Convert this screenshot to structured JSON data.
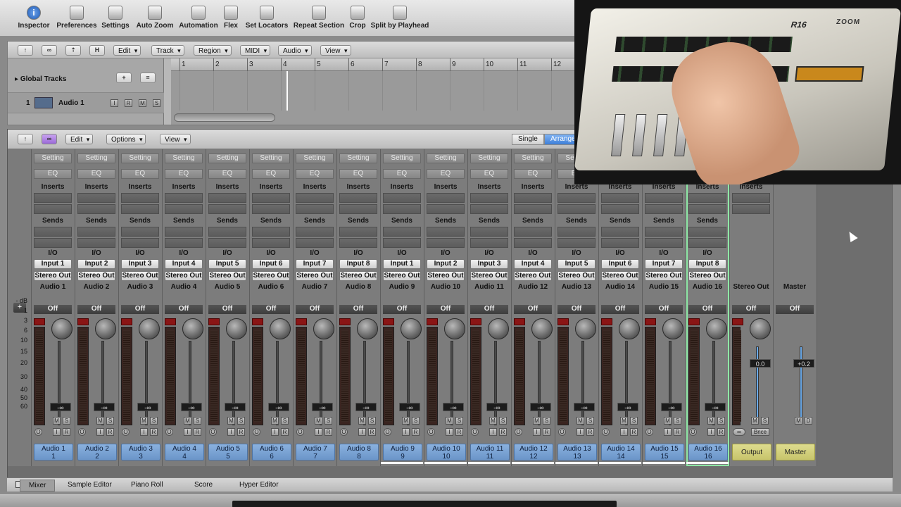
{
  "toolbar": {
    "items": [
      {
        "label": "Inspector",
        "icon": "info-icon"
      },
      {
        "label": "Preferences",
        "icon": "preferences-icon"
      },
      {
        "label": "Settings",
        "icon": "settings-icon"
      },
      {
        "label": "Auto Zoom",
        "icon": "zoom-icon"
      },
      {
        "label": "Automation",
        "icon": "automation-icon"
      },
      {
        "label": "Flex",
        "icon": "flex-icon"
      },
      {
        "label": "Set Locators",
        "icon": "locators-icon"
      },
      {
        "label": "Repeat Section",
        "icon": "repeat-icon"
      },
      {
        "label": "Crop",
        "icon": "crop-icon"
      },
      {
        "label": "Split by Playhead",
        "icon": "split-icon"
      }
    ]
  },
  "arrange": {
    "menus": [
      "Edit",
      "Track",
      "Region",
      "MIDI",
      "Audio",
      "View"
    ],
    "global_tracks": "Global Tracks",
    "track": {
      "number": "1",
      "name": "Audio 1",
      "buttons": [
        "I",
        "R",
        "M",
        "S"
      ]
    },
    "ruler": [
      "1",
      "2",
      "3",
      "4",
      "5",
      "6",
      "7",
      "8",
      "9",
      "10",
      "11",
      "12"
    ]
  },
  "mixer": {
    "menus": [
      "Edit",
      "Options",
      "View"
    ],
    "view_modes": [
      "Single",
      "Arrange"
    ],
    "active_view": "Arrange",
    "slot_labels": {
      "setting": "Setting",
      "eq": "EQ",
      "inserts": "Inserts",
      "sends": "Sends",
      "io": "I/O",
      "off": "Off"
    },
    "db_scale": [
      "- dB",
      "1",
      "3",
      "6",
      "10",
      "15",
      "20",
      "30",
      "40",
      "50",
      "60"
    ],
    "strips": [
      {
        "input": "Input 1",
        "output": "Stereo Out",
        "name": "Audio 1",
        "tag": "Audio 1",
        "num": "1",
        "val": "-∞"
      },
      {
        "input": "Input 2",
        "output": "Stereo Out",
        "name": "Audio 2",
        "tag": "Audio 2",
        "num": "2",
        "val": "-∞"
      },
      {
        "input": "Input 3",
        "output": "Stereo Out",
        "name": "Audio 3",
        "tag": "Audio 3",
        "num": "3",
        "val": "-∞"
      },
      {
        "input": "Input 4",
        "output": "Stereo Out",
        "name": "Audio 4",
        "tag": "Audio 4",
        "num": "4",
        "val": "-∞"
      },
      {
        "input": "Input 5",
        "output": "Stereo Out",
        "name": "Audio 5",
        "tag": "Audio 5",
        "num": "5",
        "val": "-∞"
      },
      {
        "input": "Input 6",
        "output": "Stereo Out",
        "name": "Audio 6",
        "tag": "Audio 6",
        "num": "6",
        "val": "-∞"
      },
      {
        "input": "Input 7",
        "output": "Stereo Out",
        "name": "Audio 7",
        "tag": "Audio 7",
        "num": "7",
        "val": "-∞"
      },
      {
        "input": "Input 8",
        "output": "Stereo Out",
        "name": "Audio 8",
        "tag": "Audio 8",
        "num": "8",
        "val": "-∞"
      },
      {
        "input": "Input 1",
        "output": "Stereo Out",
        "name": "Audio 9",
        "tag": "Audio 9",
        "num": "9",
        "val": "-∞"
      },
      {
        "input": "Input 2",
        "output": "Stereo Out",
        "name": "Audio 10",
        "tag": "Audio 10",
        "num": "10",
        "val": "-∞"
      },
      {
        "input": "Input 3",
        "output": "Stereo Out",
        "name": "Audio 11",
        "tag": "Audio 11",
        "num": "11",
        "val": "-∞"
      },
      {
        "input": "Input 4",
        "output": "Stereo Out",
        "name": "Audio 12",
        "tag": "Audio 12",
        "num": "12",
        "val": "-∞"
      },
      {
        "input": "Input 5",
        "output": "Stereo Out",
        "name": "Audio 13",
        "tag": "Audio 13",
        "num": "13",
        "val": "-∞"
      },
      {
        "input": "Input 6",
        "output": "Stereo Out",
        "name": "Audio 14",
        "tag": "Audio 14",
        "num": "14",
        "val": "-∞"
      },
      {
        "input": "Input 7",
        "output": "Stereo Out",
        "name": "Audio 15",
        "tag": "Audio 15",
        "num": "15",
        "val": "-∞"
      },
      {
        "input": "Input 8",
        "output": "Stereo Out",
        "name": "Audio 16",
        "tag": "Audio 16",
        "num": "16",
        "val": "-∞"
      }
    ],
    "output_strip": {
      "name": "Stereo Out",
      "tag": "Output",
      "val": "0.0"
    },
    "master_strip": {
      "name": "Master",
      "tag": "Master",
      "val": "+0.2"
    }
  },
  "bottom_tabs": [
    "Mixer",
    "Sample Editor",
    "Piano Roll",
    "Score",
    "Hyper Editor"
  ],
  "video": {
    "brand": "R16",
    "maker": "ZOOM"
  }
}
